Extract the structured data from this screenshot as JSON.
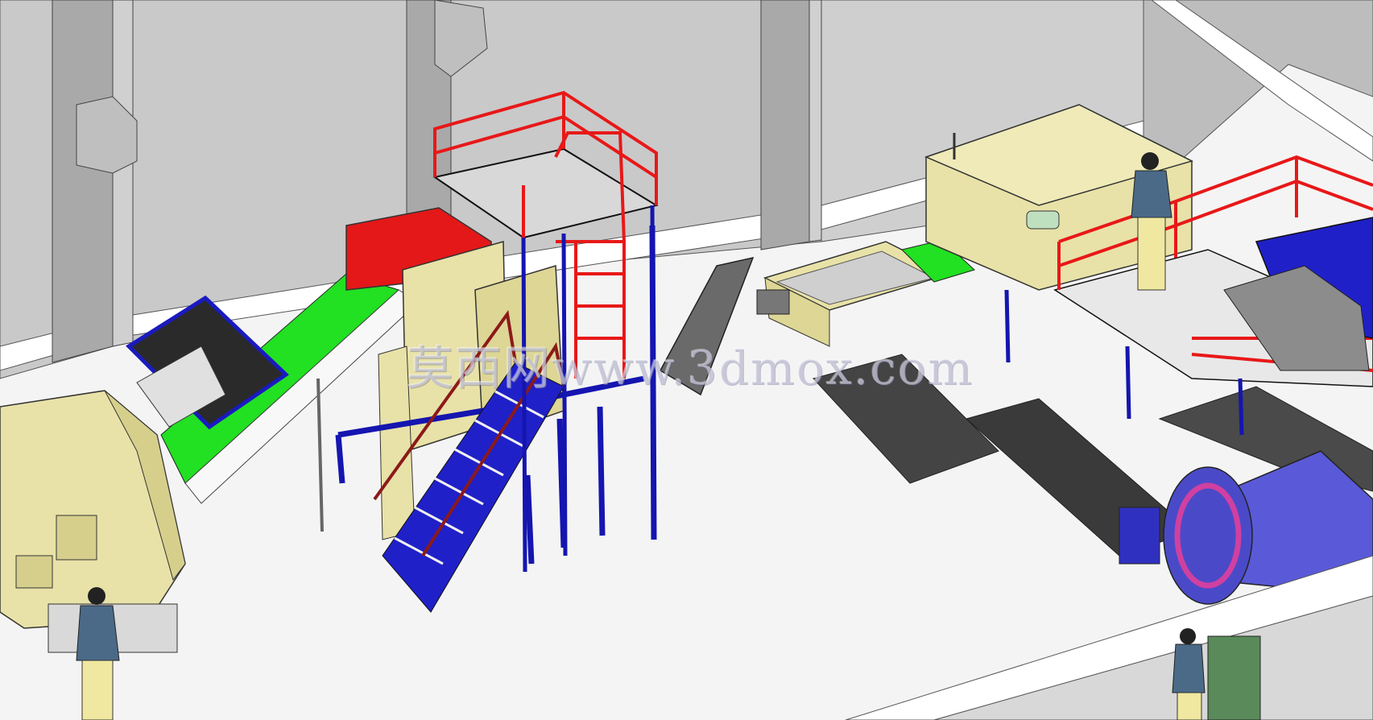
{
  "watermark": {
    "text": "莫西网www.3dmox.com"
  },
  "colors": {
    "wall": "#c8c8c8",
    "wall_dark": "#9e9e9e",
    "floor": "#f4f4f4",
    "machine_yellow": "#e8e2a8",
    "machine_blue": "#2020c8",
    "railing_red": "#e81818",
    "belt_green": "#22e022",
    "belt_grey": "#5a5a5a",
    "worker_shirt": "#4a6a88",
    "worker_pants": "#f0e8a0"
  }
}
